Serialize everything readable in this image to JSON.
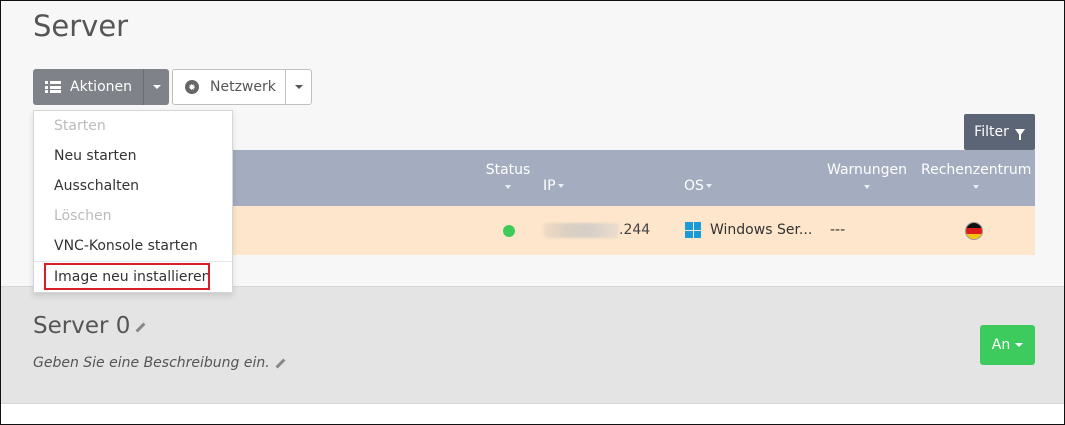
{
  "page": {
    "title": "Server"
  },
  "toolbar": {
    "actions_label": "Aktionen",
    "network_label": "Netzwerk",
    "filter_label": "Filter"
  },
  "dropdown": {
    "items": [
      {
        "label": "Starten",
        "disabled": true
      },
      {
        "label": "Neu starten",
        "disabled": false
      },
      {
        "label": "Ausschalten",
        "disabled": false
      },
      {
        "label": "Löschen",
        "disabled": true
      },
      {
        "label": "VNC-Konsole starten",
        "disabled": false
      },
      {
        "label": "Image neu installieren",
        "disabled": false,
        "highlighted": true
      }
    ]
  },
  "table": {
    "headers": {
      "status": "Status",
      "ip": "IP",
      "os": "OS",
      "warnings": "Warnungen",
      "datacenter": "Rechenzentrum"
    },
    "row": {
      "status_color": "#3ecb5a",
      "ip_suffix": ".244",
      "os": "Windows Ser...",
      "os_icon": "windows-logo-icon",
      "warnings": "---",
      "datacenter_flag": "germany-flag-icon"
    }
  },
  "detail": {
    "server_name": "Server 0",
    "description_placeholder": "Geben Sie eine Beschreibung ein.",
    "power_label": "An",
    "power_color": "#3dcb5e"
  },
  "colors": {
    "table_header": "#a3adbf",
    "row_highlight": "#fde6cb",
    "filter_button": "#5b6576",
    "highlight_border": "#d81f27"
  }
}
